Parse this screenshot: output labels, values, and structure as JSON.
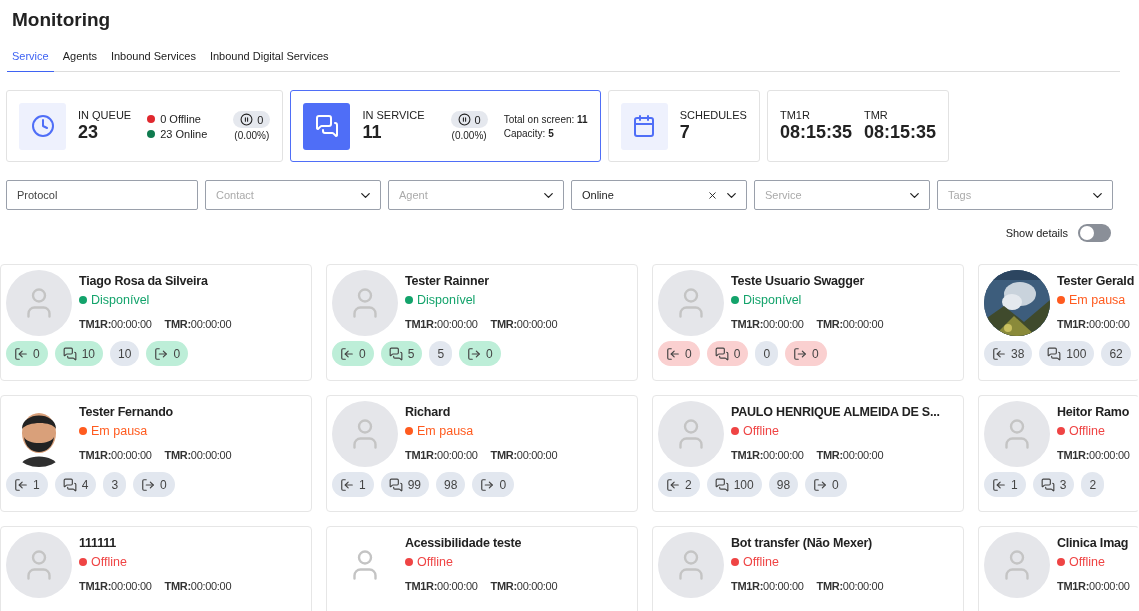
{
  "title": "Monitoring",
  "tabs": [
    {
      "label": "Service",
      "selected": true
    },
    {
      "label": "Agents",
      "selected": false
    },
    {
      "label": "Inbound Services",
      "selected": false
    },
    {
      "label": "Inbound Digital Services",
      "selected": false
    }
  ],
  "stats": [
    {
      "kind": "queue",
      "label": "IN QUEUE",
      "value": "23",
      "selected": false,
      "legend": [
        {
          "text": "0 Offline",
          "color": "#e0282e"
        },
        {
          "text": "23 Online",
          "color": "#0f7b4f"
        }
      ],
      "paused": "0",
      "paused_share": "(0.00%)"
    },
    {
      "kind": "service",
      "label": "IN SERVICE",
      "value": "11",
      "selected": true,
      "paused": "0",
      "paused_share": "(0.00%)",
      "totals": [
        {
          "label": "Total on screen:",
          "value": "11"
        },
        {
          "label": "Capacity:",
          "value": "5"
        }
      ]
    },
    {
      "kind": "schedules",
      "label": "SCHEDULES",
      "value": "7",
      "selected": false
    },
    {
      "kind": "times",
      "selected": false,
      "times": [
        {
          "label": "TM1R",
          "value": "08:15:35"
        },
        {
          "label": "TMR",
          "value": "08:15:35"
        }
      ]
    }
  ],
  "filters": [
    {
      "kind": "text",
      "placeholder": "Protocol"
    },
    {
      "kind": "select",
      "placeholder": "Contact"
    },
    {
      "kind": "select",
      "placeholder": "Agent"
    },
    {
      "kind": "select",
      "value": "Online",
      "clearable": true
    },
    {
      "kind": "select",
      "placeholder": "Service"
    },
    {
      "kind": "select",
      "placeholder": "Tags"
    }
  ],
  "show_details": {
    "label": "Show details",
    "on": false
  },
  "agents": [
    {
      "name": "Tiago Rosa da Silveira",
      "avatar": {
        "kind": "placeholder"
      },
      "status": {
        "label": "Disponível",
        "color": "#13a36b"
      },
      "times": [
        {
          "label": "TM1R:",
          "value": "00:00:00"
        },
        {
          "label": "TMR:",
          "value": "00:00:00"
        }
      ],
      "counters": [
        {
          "kind": "entry",
          "value": "0",
          "color": "#bdeed8"
        },
        {
          "kind": "chat",
          "value": "10",
          "color": "#bdeed8"
        },
        {
          "kind": "plain",
          "value": "10",
          "color": "#e2e7ef"
        },
        {
          "kind": "exit",
          "value": "0",
          "color": "#bdeed8"
        }
      ]
    },
    {
      "name": "Tester Rainner",
      "avatar": {
        "kind": "placeholder"
      },
      "status": {
        "label": "Disponível",
        "color": "#13a36b"
      },
      "times": [
        {
          "label": "TM1R:",
          "value": "00:00:00"
        },
        {
          "label": "TMR:",
          "value": "00:00:00"
        }
      ],
      "counters": [
        {
          "kind": "entry",
          "value": "0",
          "color": "#bdeed8"
        },
        {
          "kind": "chat",
          "value": "5",
          "color": "#bdeed8"
        },
        {
          "kind": "plain",
          "value": "5",
          "color": "#e2e7ef"
        },
        {
          "kind": "exit",
          "value": "0",
          "color": "#bdeed8"
        }
      ]
    },
    {
      "name": "Teste Usuario Swagger",
      "avatar": {
        "kind": "placeholder"
      },
      "status": {
        "label": "Disponível",
        "color": "#13a36b"
      },
      "times": [
        {
          "label": "TM1R:",
          "value": "00:00:00"
        },
        {
          "label": "TMR:",
          "value": "00:00:00"
        }
      ],
      "counters": [
        {
          "kind": "entry",
          "value": "0",
          "color": "#fad0d0"
        },
        {
          "kind": "chat",
          "value": "0",
          "color": "#fad0d0"
        },
        {
          "kind": "plain",
          "value": "0",
          "color": "#e2e7ef"
        },
        {
          "kind": "exit",
          "value": "0",
          "color": "#fad0d0"
        }
      ]
    },
    {
      "name": "Tester Gerald",
      "avatar": {
        "kind": "picture"
      },
      "status": {
        "label": "Em pausa",
        "color": "#ff5b1f"
      },
      "times": [
        {
          "label": "TM1R:",
          "value": "00:00:00"
        }
      ],
      "counters": [
        {
          "kind": "entry",
          "value": "38",
          "color": "#e2e7ef"
        },
        {
          "kind": "chat",
          "value": "100",
          "color": "#e2e7ef"
        },
        {
          "kind": "plain",
          "value": "62",
          "color": "#e2e7ef"
        }
      ]
    },
    {
      "name": "Tester Fernando",
      "avatar": {
        "kind": "figure"
      },
      "status": {
        "label": "Em pausa",
        "color": "#ff5b1f"
      },
      "times": [
        {
          "label": "TM1R:",
          "value": "00:00:00"
        },
        {
          "label": "TMR:",
          "value": "00:00:00"
        }
      ],
      "counters": [
        {
          "kind": "entry",
          "value": "1",
          "color": "#e2e7ef"
        },
        {
          "kind": "chat",
          "value": "4",
          "color": "#e2e7ef"
        },
        {
          "kind": "plain",
          "value": "3",
          "color": "#e2e7ef"
        },
        {
          "kind": "exit",
          "value": "0",
          "color": "#e2e7ef"
        }
      ]
    },
    {
      "name": "Richard",
      "avatar": {
        "kind": "placeholder"
      },
      "status": {
        "label": "Em pausa",
        "color": "#ff5b1f"
      },
      "times": [
        {
          "label": "TM1R:",
          "value": "00:00:00"
        },
        {
          "label": "TMR:",
          "value": "00:00:00"
        }
      ],
      "counters": [
        {
          "kind": "entry",
          "value": "1",
          "color": "#e2e7ef"
        },
        {
          "kind": "chat",
          "value": "99",
          "color": "#e2e7ef"
        },
        {
          "kind": "plain",
          "value": "98",
          "color": "#e2e7ef"
        },
        {
          "kind": "exit",
          "value": "0",
          "color": "#e2e7ef"
        }
      ]
    },
    {
      "name": "PAULO HENRIQUE ALMEIDA DE S...",
      "avatar": {
        "kind": "placeholder"
      },
      "status": {
        "label": "Offline",
        "color": "#ef4444"
      },
      "times": [
        {
          "label": "TM1R:",
          "value": "00:00:00"
        },
        {
          "label": "TMR:",
          "value": "00:00:00"
        }
      ],
      "counters": [
        {
          "kind": "entry",
          "value": "2",
          "color": "#e2e7ef"
        },
        {
          "kind": "chat",
          "value": "100",
          "color": "#e2e7ef"
        },
        {
          "kind": "plain",
          "value": "98",
          "color": "#e2e7ef"
        },
        {
          "kind": "exit",
          "value": "0",
          "color": "#e2e7ef"
        }
      ]
    },
    {
      "name": "Heitor Ramo",
      "avatar": {
        "kind": "placeholder"
      },
      "status": {
        "label": "Offline",
        "color": "#ef4444"
      },
      "times": [
        {
          "label": "TM1R:",
          "value": "00:00:00"
        }
      ],
      "counters": [
        {
          "kind": "entry",
          "value": "1",
          "color": "#e2e7ef"
        },
        {
          "kind": "chat",
          "value": "3",
          "color": "#e2e7ef"
        },
        {
          "kind": "plain",
          "value": "2",
          "color": "#e2e7ef"
        }
      ]
    },
    {
      "name": "111111",
      "avatar": {
        "kind": "placeholder"
      },
      "status": {
        "label": "Offline",
        "color": "#ef4444"
      },
      "times": [
        {
          "label": "TM1R:",
          "value": "00:00:00"
        },
        {
          "label": "TMR:",
          "value": "00:00:00"
        }
      ]
    },
    {
      "name": "Acessibilidade teste",
      "avatar": {
        "kind": "icon"
      },
      "status": {
        "label": "Offline",
        "color": "#ef4444"
      },
      "times": [
        {
          "label": "TM1R:",
          "value": "00:00:00"
        },
        {
          "label": "TMR:",
          "value": "00:00:00"
        }
      ]
    },
    {
      "name": "Bot transfer (Não Mexer)",
      "avatar": {
        "kind": "placeholder"
      },
      "status": {
        "label": "Offline",
        "color": "#ef4444"
      },
      "times": [
        {
          "label": "TM1R:",
          "value": "00:00:00"
        },
        {
          "label": "TMR:",
          "value": "00:00:00"
        }
      ]
    },
    {
      "name": "Clinica Imag",
      "avatar": {
        "kind": "placeholder"
      },
      "status": {
        "label": "Offline",
        "color": "#ef4444"
      },
      "times": [
        {
          "label": "TM1R:",
          "value": "00:00:00"
        }
      ]
    }
  ]
}
